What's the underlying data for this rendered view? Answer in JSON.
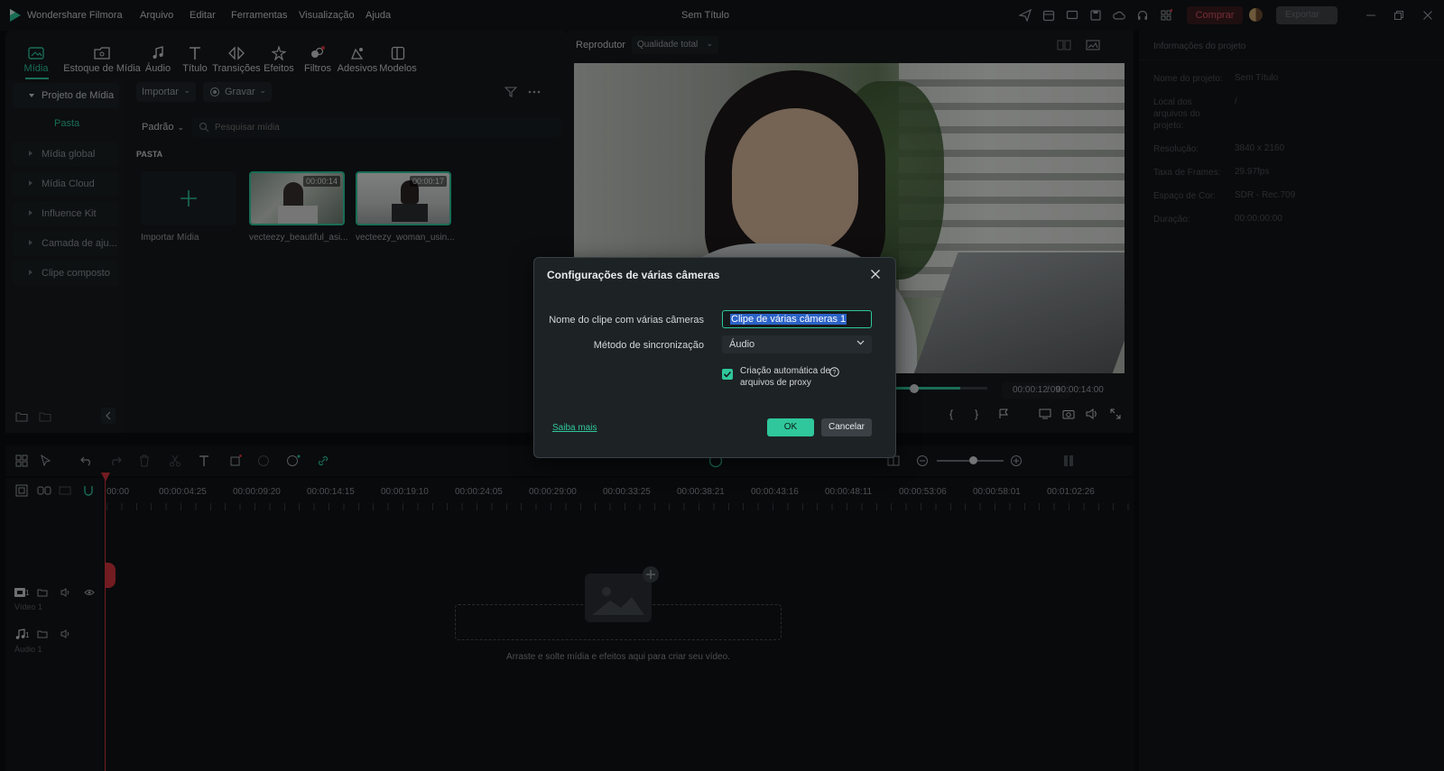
{
  "app": {
    "name": "Wondershare Filmora",
    "document_title": "Sem Título",
    "menu": [
      "Arquivo",
      "Editar",
      "Ferramentas",
      "Visualização",
      "Ajuda"
    ],
    "buy_label": "Comprar",
    "export_label": "Exportar"
  },
  "tabs": [
    {
      "label": "Mídia",
      "icon": "media-icon"
    },
    {
      "label": "Estoque de Mídia",
      "icon": "stock-media-icon"
    },
    {
      "label": "Áudio",
      "icon": "audio-icon"
    },
    {
      "label": "Título",
      "icon": "title-icon"
    },
    {
      "label": "Transições",
      "icon": "transitions-icon"
    },
    {
      "label": "Efeitos",
      "icon": "effects-icon"
    },
    {
      "label": "Filtros",
      "icon": "filters-icon"
    },
    {
      "label": "Adesivos",
      "icon": "stickers-icon"
    },
    {
      "label": "Modelos",
      "icon": "templates-icon"
    }
  ],
  "sidebar": {
    "project_media": "Projeto de Mídia",
    "folder": "Pasta",
    "items": [
      "Mídia global",
      "Mídia Cloud",
      "Influence Kit",
      "Camada de aju...",
      "Clipe composto"
    ]
  },
  "media": {
    "import_label": "Importar",
    "record_label": "Gravar",
    "sort_label": "Padrão",
    "search_placeholder": "Pesquisar mídia",
    "folder_header": "PASTA",
    "import_media_label": "Importar Mídia",
    "clips": [
      {
        "name": "vecteezy_beautiful_asi...",
        "duration": "00:00:14"
      },
      {
        "name": "vecteezy_woman_usin...",
        "duration": "00:00:17"
      }
    ]
  },
  "player": {
    "label": "Reprodutor",
    "quality": "Qualidade total",
    "current_time": "00:00:12:09",
    "separator": "/",
    "total_time": "00:00:14:00",
    "progress": 0.86
  },
  "project_info": {
    "title": "Informações do projeto",
    "rows": [
      {
        "label": "Nome do projeto:",
        "value": "Sem Título"
      },
      {
        "label": "Local dos arquivos do projeto:",
        "value": "/"
      },
      {
        "label": "Resolução:",
        "value": "3840 x 2160"
      },
      {
        "label": "Taxa de Frames:",
        "value": "29.97fps"
      },
      {
        "label": "Espaço de Cor:",
        "value": "SDR - Rec.709"
      },
      {
        "label": "Duração:",
        "value": "00:00:00:00"
      }
    ]
  },
  "timeline": {
    "ticks": [
      "00:00",
      "00:00:04:25",
      "00:00:09:20",
      "00:00:14:15",
      "00:00:19:10",
      "00:00:24:05",
      "00:00:29:00",
      "00:00:33:25",
      "00:00:38:21",
      "00:00:43:16",
      "00:00:48:11",
      "00:00:53:06",
      "00:00:58:01",
      "00:01:02:26"
    ],
    "video_track": "Vídeo 1",
    "audio_track": "Áudio 1",
    "track_num": "1",
    "drop_hint": "Arraste e solte mídia e efeitos aqui para criar seu vídeo."
  },
  "dialog": {
    "title": "Configurações de várias câmeras",
    "name_label": "Nome do clipe com várias câmeras",
    "name_value": "Clipe de várias câmeras 1",
    "sync_label": "Método de sincronização",
    "sync_value": "Áudio",
    "proxy_line1": "Criação automática de",
    "proxy_line2": "arquivos de proxy",
    "proxy_checked": true,
    "learn_more": "Saiba mais",
    "ok": "OK",
    "cancel": "Cancelar"
  },
  "colors": {
    "accent": "#2fc79b",
    "buy": "#c83c4a",
    "playhead": "#d0343f"
  }
}
